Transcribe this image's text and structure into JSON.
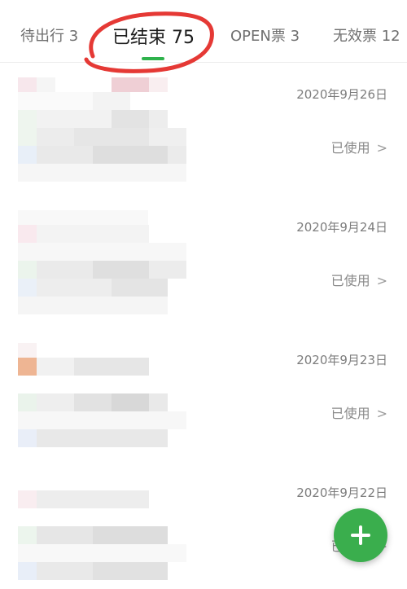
{
  "tabs": [
    {
      "label": "待出行 3"
    },
    {
      "label": "已结束 75"
    },
    {
      "label": "OPEN票 3"
    },
    {
      "label": "无效票 12"
    }
  ],
  "tickets": [
    {
      "date": "2020年9月26日",
      "status": "已使用"
    },
    {
      "date": "2020年9月24日",
      "status": "已使用"
    },
    {
      "date": "2020年9月23日",
      "status": "已使用"
    },
    {
      "date": "2020年9月22日",
      "status": "已使用"
    }
  ],
  "colors": {
    "accent": "#2fb24c",
    "annotation": "#e53935",
    "fab": "#3aae4d"
  },
  "icons": {
    "fab": "plus-icon",
    "chevron": "chevron-right-icon"
  }
}
